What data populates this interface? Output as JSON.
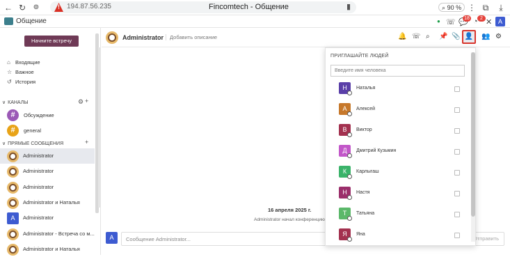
{
  "browser": {
    "url": "194.87.56.235",
    "page_title": "Fincomtech - Общение",
    "zoom": "90 %"
  },
  "app": {
    "name": "Общение",
    "badges": {
      "chat": "18",
      "activity": "2"
    },
    "user_initial": "A"
  },
  "sidebar": {
    "start_meeting": "Начните встречу",
    "nav": [
      {
        "icon": "inbox-icon",
        "label": "Входящие"
      },
      {
        "icon": "star-icon",
        "label": "Важное"
      },
      {
        "icon": "history-icon",
        "label": "История"
      }
    ],
    "channels_header": "КАНАЛЫ",
    "channels": [
      {
        "label": "Обсуждение",
        "color": "#9b59b6"
      },
      {
        "label": "general",
        "color": "#e8a317"
      }
    ],
    "dm_header": "ПРЯМЫЕ СООБЩЕНИЯ",
    "direct": [
      {
        "label": "Administrator",
        "active": true
      },
      {
        "label": "Administrator"
      },
      {
        "label": "Administrator"
      },
      {
        "label": "Administrator и Наталья"
      },
      {
        "label": "Administrator",
        "initial": "A"
      },
      {
        "label": "Administrator - Встреча со м..."
      },
      {
        "label": "Administrator и Наталья"
      }
    ]
  },
  "chat": {
    "name": "Administrator",
    "description_placeholder": "Добавить описание",
    "date_separator": "16 апреля 2025 г.",
    "system_message": "Administrator начал конференцию",
    "composer_initial": "A",
    "composer_placeholder": "Сообщение Administrator...",
    "send_label": "Отправить"
  },
  "invite": {
    "title": "ПРИГЛАШАЙТЕ ЛЮДЕЙ",
    "search_placeholder": "Введите имя человека",
    "people": [
      {
        "initial": "Н",
        "name": "Наталья",
        "color": "#5a3fa8"
      },
      {
        "initial": "А",
        "name": "Алексей",
        "color": "#c6782b"
      },
      {
        "initial": "В",
        "name": "Виктор",
        "color": "#a3314f"
      },
      {
        "initial": "Д",
        "name": "Дмитрий Кузьмин",
        "color": "#c257c9"
      },
      {
        "initial": "К",
        "name": "Карлыгаш",
        "color": "#3bb36a"
      },
      {
        "initial": "Н",
        "name": "Настя",
        "color": "#9b2f6b"
      },
      {
        "initial": "Т",
        "name": "Татьяна",
        "color": "#5bb86a"
      },
      {
        "initial": "Я",
        "name": "Яна",
        "color": "#a3314f"
      }
    ]
  }
}
